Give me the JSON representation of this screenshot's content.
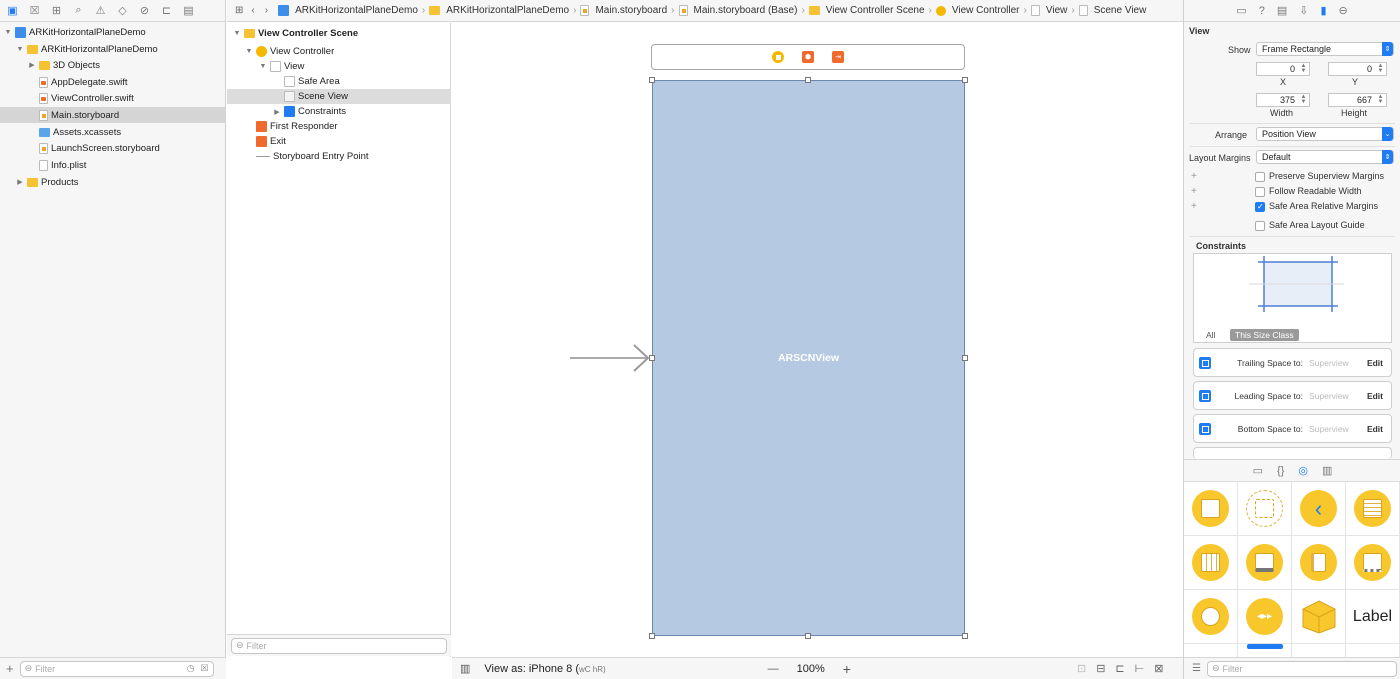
{
  "navigator": {
    "items": [
      {
        "label": "ARKitHorizontalPlaneDemo",
        "kind": "project",
        "expanded": true
      },
      {
        "label": "ARKitHorizontalPlaneDemo",
        "kind": "folder",
        "expanded": true
      },
      {
        "label": "3D Objects",
        "kind": "folder",
        "expanded": false
      },
      {
        "label": "AppDelegate.swift",
        "kind": "swift"
      },
      {
        "label": "ViewController.swift",
        "kind": "swift"
      },
      {
        "label": "Main.storyboard",
        "kind": "storyboard",
        "selected": true
      },
      {
        "label": "Assets.xcassets",
        "kind": "assets"
      },
      {
        "label": "LaunchScreen.storyboard",
        "kind": "storyboard"
      },
      {
        "label": "Info.plist",
        "kind": "file"
      },
      {
        "label": "Products",
        "kind": "folder",
        "expanded": false
      }
    ],
    "filter_placeholder": "Filter"
  },
  "breadcrumb": [
    "ARKitHorizontalPlaneDemo",
    "ARKitHorizontalPlaneDemo",
    "Main.storyboard",
    "Main.storyboard (Base)",
    "View Controller Scene",
    "View Controller",
    "View",
    "Scene View"
  ],
  "outline": {
    "items": [
      {
        "label": "View Controller Scene",
        "bold": true
      },
      {
        "label": "View Controller"
      },
      {
        "label": "View"
      },
      {
        "label": "Safe Area"
      },
      {
        "label": "Scene View",
        "selected": true
      },
      {
        "label": "Constraints"
      },
      {
        "label": "First Responder"
      },
      {
        "label": "Exit"
      },
      {
        "label": "Storyboard Entry Point"
      }
    ],
    "filter_placeholder": "Filter"
  },
  "canvas": {
    "view_label": "ARSCNView",
    "view_as": "View as: iPhone 8 (",
    "size_class": "wC hR)",
    "zoom": "100%",
    "zoom_out": "—",
    "zoom_in": "+"
  },
  "inspector": {
    "section_title": "View",
    "show_label": "Show",
    "show_value": "Frame Rectangle",
    "x_value": "0",
    "y_value": "0",
    "x_label": "X",
    "y_label": "Y",
    "width_value": "375",
    "height_value": "667",
    "width_label": "Width",
    "height_label": "Height",
    "arrange_label": "Arrange",
    "arrange_value": "Position View",
    "layout_margins_label": "Layout Margins",
    "layout_margins_value": "Default",
    "checkboxes": [
      {
        "label": "Preserve Superview Margins",
        "checked": false
      },
      {
        "label": "Follow Readable Width",
        "checked": false
      },
      {
        "label": "Safe Area Relative Margins",
        "checked": true
      },
      {
        "label": "Safe Area Layout Guide",
        "checked": false
      }
    ],
    "constraints_title": "Constraints",
    "constraints_filter_all": "All",
    "constraints_filter_size": "This Size Class",
    "constraints": [
      {
        "label": "Trailing Space to:",
        "target": "Superview",
        "edit": "Edit"
      },
      {
        "label": "Leading Space to:",
        "target": "Superview",
        "edit": "Edit"
      },
      {
        "label": "Bottom Space to:",
        "target": "Superview",
        "edit": "Edit"
      }
    ]
  },
  "library": {
    "label_item": "Label",
    "filter_placeholder": "Filter"
  }
}
